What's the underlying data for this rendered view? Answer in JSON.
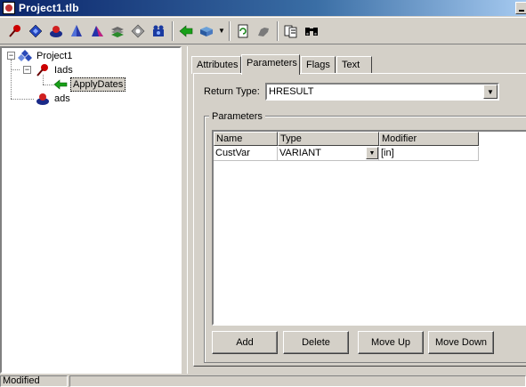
{
  "window": {
    "title": "Project1.tlb"
  },
  "toolbar": {
    "buttons": [
      "pin-icon",
      "diamond-icon",
      "interface-icon",
      "cone-icon",
      "pyramid-icon",
      "stack-icon",
      "module-icon",
      "coclass-icon",
      "arrow-icon",
      "dropdown-box-icon",
      "refresh-icon",
      "gear-icon",
      "document-icon",
      "binoculars-icon"
    ]
  },
  "tree": {
    "root": "Project1",
    "items": [
      {
        "label": "Iads"
      },
      {
        "label": "ApplyDates"
      },
      {
        "label": "ads"
      }
    ]
  },
  "tabs": [
    {
      "label": "Attributes"
    },
    {
      "label": "Parameters"
    },
    {
      "label": "Flags"
    },
    {
      "label": "Text"
    }
  ],
  "return_type": {
    "label": "Return Type:",
    "value": "HRESULT"
  },
  "parameters_group": {
    "title": "Parameters"
  },
  "grid": {
    "columns": [
      "Name",
      "Type",
      "Modifier"
    ],
    "rows": [
      {
        "name": "CustVar",
        "type": "VARIANT",
        "modifier": "[in]"
      }
    ]
  },
  "buttons": {
    "add": "Add",
    "delete": "Delete",
    "move_up": "Move Up",
    "move_down": "Move Down"
  },
  "status": {
    "text": "Modified"
  }
}
